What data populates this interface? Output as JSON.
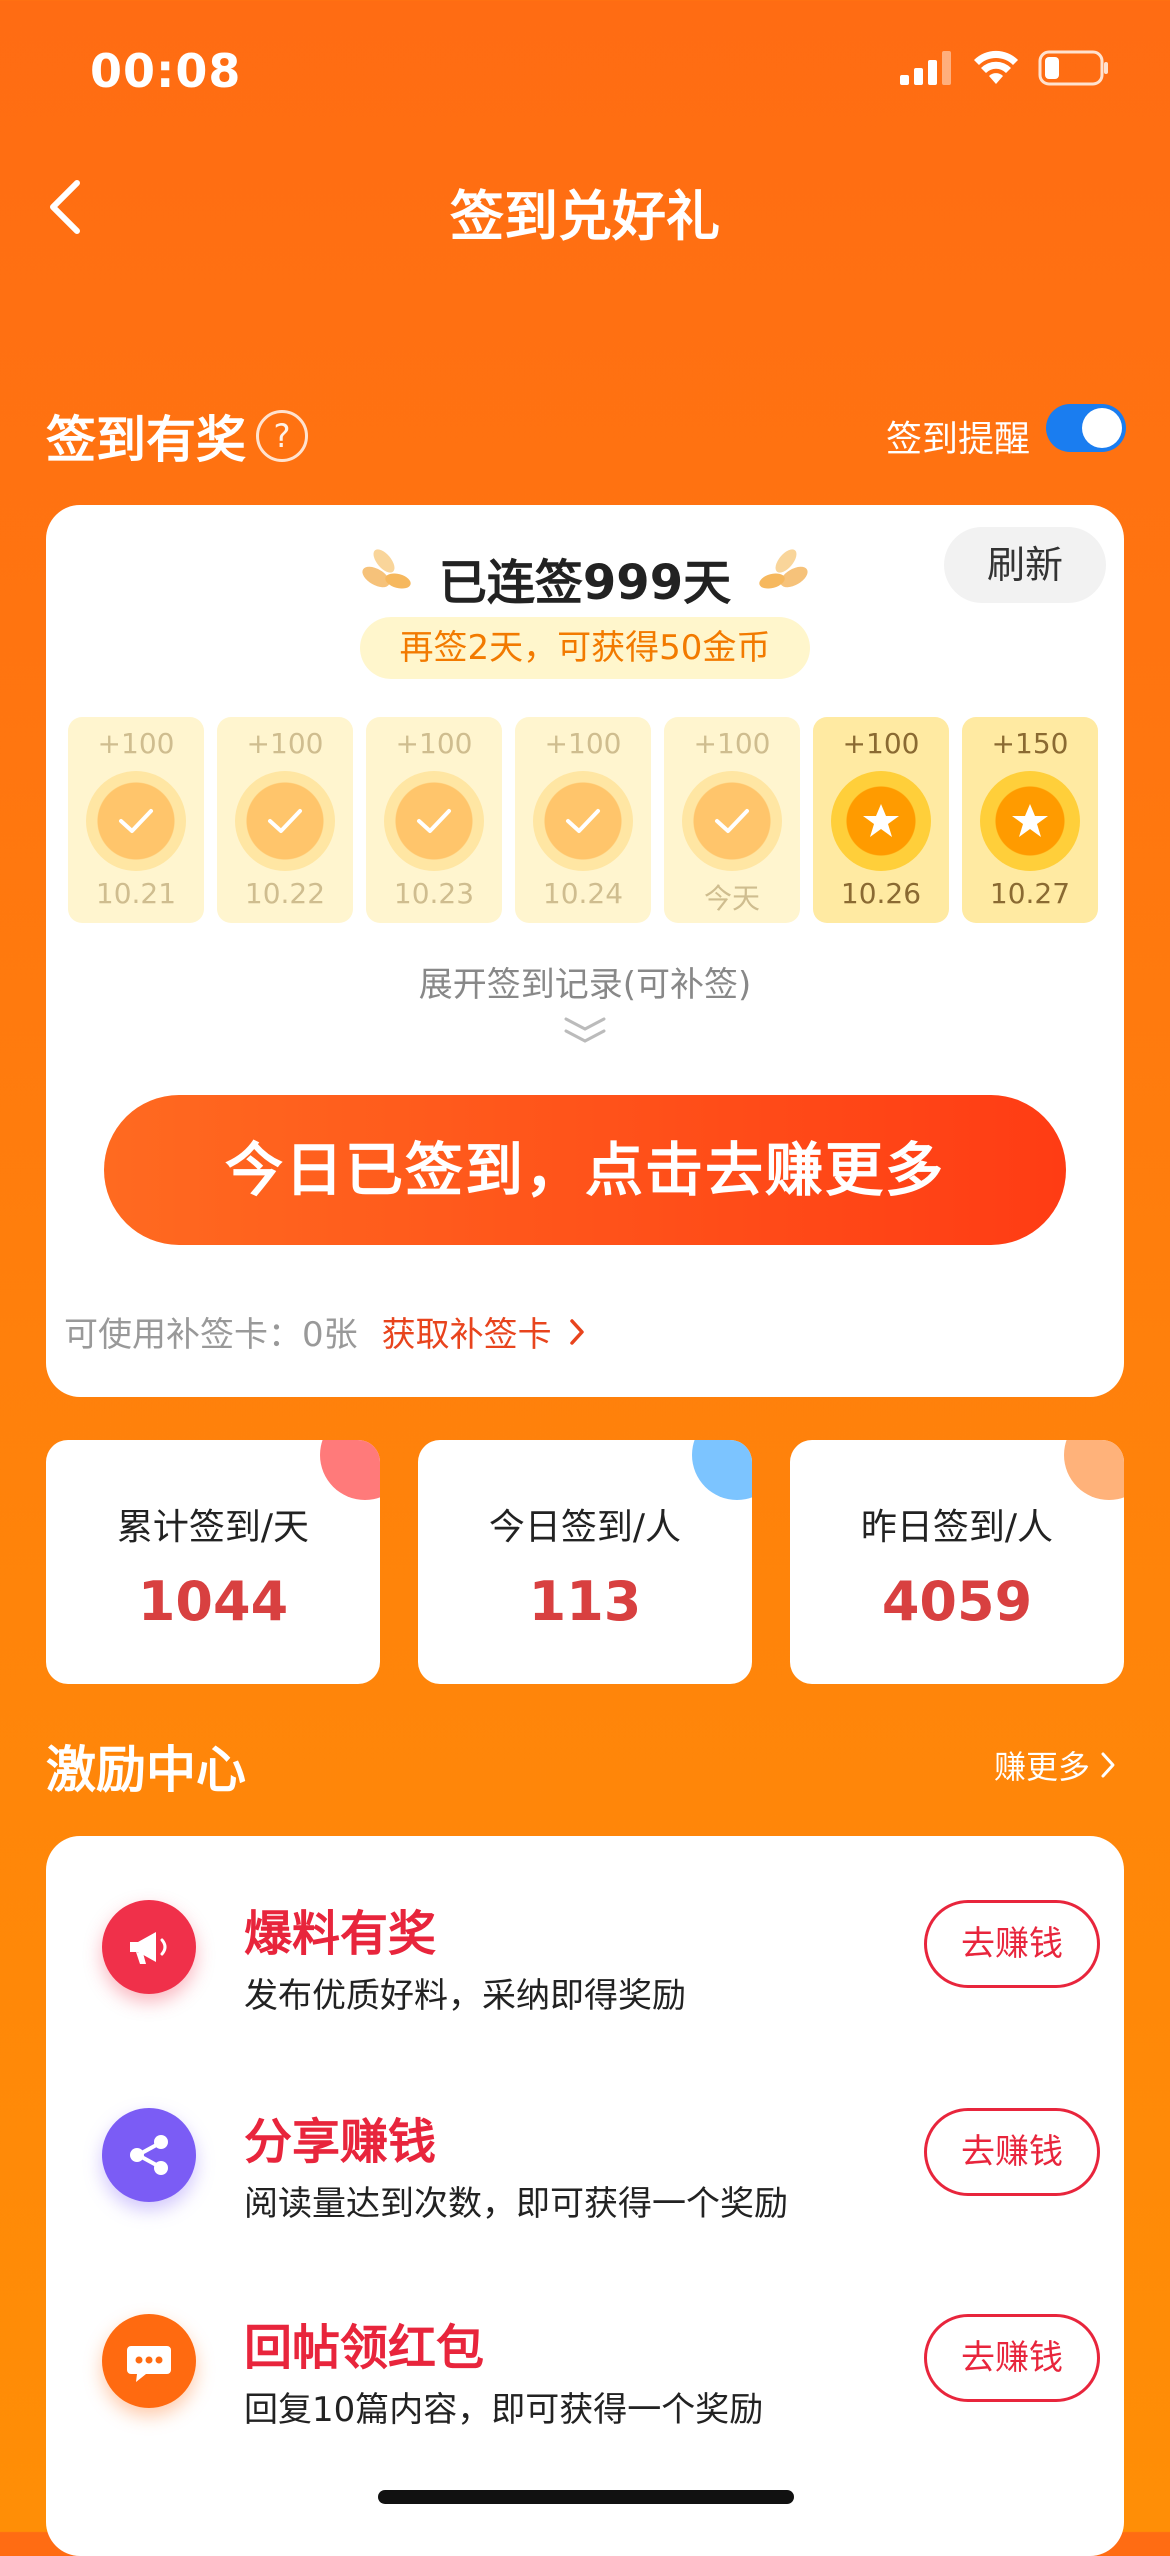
{
  "status_bar": {
    "time": "00:08"
  },
  "nav": {
    "title": "签到兑好礼"
  },
  "signin_section": {
    "title": "签到有奖",
    "help_mark": "?",
    "reminder_label": "签到提醒",
    "reminder_on": true
  },
  "signin_card": {
    "streak": "已连签999天",
    "refresh": "刷新",
    "hint": "再签2天，可获得50金币",
    "days": [
      {
        "points": "+100",
        "date": "10.21",
        "state": "done"
      },
      {
        "points": "+100",
        "date": "10.22",
        "state": "done"
      },
      {
        "points": "+100",
        "date": "10.23",
        "state": "done"
      },
      {
        "points": "+100",
        "date": "10.24",
        "state": "done"
      },
      {
        "points": "+100",
        "date": "今天",
        "state": "done"
      },
      {
        "points": "+100",
        "date": "10.26",
        "state": "future"
      },
      {
        "points": "+150",
        "date": "10.27",
        "state": "future"
      }
    ],
    "expand": "展开签到记录(可补签)",
    "cta": "今日已签到，点击去赚更多",
    "makeup_label": "可使用补签卡：",
    "makeup_count": "0张",
    "makeup_link": "获取补签卡"
  },
  "stats": [
    {
      "label": "累计签到/天",
      "value": "1044",
      "color": "#ff7a7a"
    },
    {
      "label": "今日签到/人",
      "value": "113",
      "color": "#7cc4ff"
    },
    {
      "label": "昨日签到/人",
      "value": "4059",
      "color": "#ffb27a"
    }
  ],
  "incentive": {
    "title": "激励中心",
    "more": "赚更多",
    "tasks": [
      {
        "title": "爆料有奖",
        "desc": "发布优质好料，采纳即得奖励",
        "button": "去赚钱",
        "icon": "megaphone-icon",
        "color": "#f0304a"
      },
      {
        "title": "分享赚钱",
        "desc": "阅读量达到次数，即可获得一个奖励",
        "button": "去赚钱",
        "icon": "share-icon",
        "color": "#7b5cf5"
      },
      {
        "title": "回帖领红包",
        "desc": "回复10篇内容，即可获得一个奖励",
        "button": "去赚钱",
        "icon": "chat-bubble-icon",
        "color": "#ff6a10"
      }
    ]
  },
  "colors": {
    "accent": "#ff6c13",
    "cta": "#ff3c14",
    "stat_value": "#d84040",
    "task_red": "#e8253c"
  }
}
